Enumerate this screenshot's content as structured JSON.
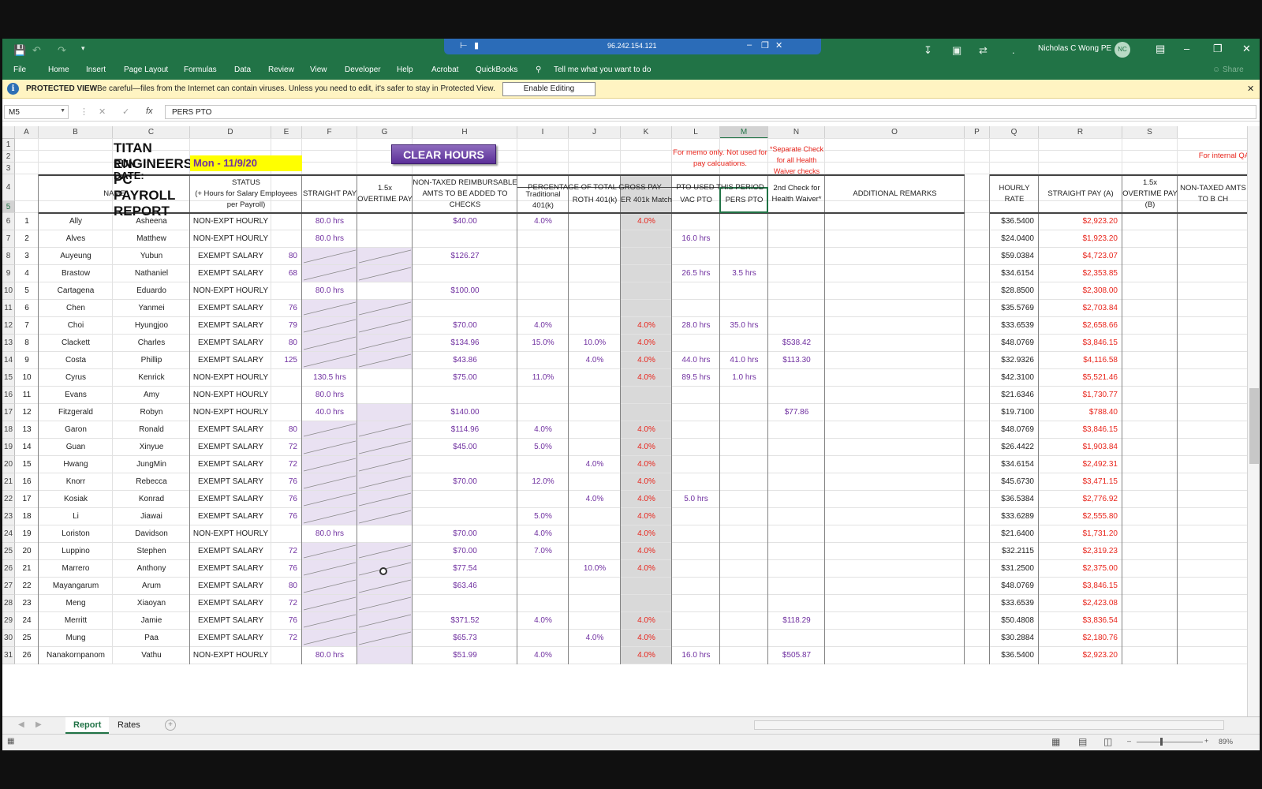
{
  "titlebar": {
    "remote_ip": "96.242.154.121",
    "user_name": "Nicholas C Wong PE",
    "user_initials": "NC"
  },
  "menu": [
    "File",
    "Home",
    "Insert",
    "Page Layout",
    "Formulas",
    "Data",
    "Review",
    "View",
    "Developer",
    "Help",
    "Acrobat",
    "QuickBooks"
  ],
  "tell_me": "Tell me what you want to do",
  "share": "Share",
  "protected_view": {
    "title": "PROTECTED VIEW",
    "message": "Be careful—files from the Internet can contain viruses. Unless you need to edit, it's safer to stay in Protected View.",
    "button": "Enable Editing"
  },
  "formula_bar": {
    "cell_ref": "M5",
    "fx": "fx",
    "content": "PERS PTO"
  },
  "columns": [
    "A",
    "B",
    "C",
    "D",
    "E",
    "F",
    "G",
    "H",
    "I",
    "J",
    "K",
    "L",
    "M",
    "N",
    "O",
    "P",
    "Q",
    "R",
    "S"
  ],
  "selected_column": "M",
  "report": {
    "title": "TITAN ENGINEERS PC PAYROLL REPORT",
    "run_date_label": "RUN DATE:",
    "run_date": "Mon - 11/9/20",
    "clear_button": "CLEAR HOURS",
    "memo_note": "For memo only. Not used for pay calcuations.",
    "separate_note": "*Separate Check for all Health Waiver checks",
    "internal_note": "For internal QA/QC"
  },
  "headers": {
    "name": "NAME",
    "status": "STATUS\n(+ Hours for Salary Employees per Payroll)",
    "straight_pay": "STRAIGHT PAY",
    "overtime": "1.5x OVERTIME PAY",
    "non_taxed": "NON-TAXED REIMBURSABLE AMTS TO BE ADDED TO CHECKS",
    "pct_group": "PERCENTAGE OF TOTAL GROSS PAY",
    "trad_401k": "Traditional 401(k)",
    "roth_401k": "ROTH 401(k)",
    "er_401k": "ER 401k Match",
    "pto_group": "PTO USED THIS PERIOD",
    "vac_pto": "VAC PTO",
    "pers_pto": "PERS PTO",
    "health_waiver": "2nd Check for Health Waiver*",
    "remarks": "ADDITIONAL REMARKS",
    "hourly_rate": "HOURLY RATE",
    "straight_pay_a": "STRAIGHT PAY (A)",
    "overtime_b": "1.5x OVERTIME PAY (B)",
    "non_taxed_trunc": "NON-TAXED AMTS TO B CH"
  },
  "employees": [
    {
      "n": "1",
      "last": "Ally",
      "first": "Asheena",
      "status": "NON-EXPT HOURLY",
      "hrs": "",
      "straight": "80.0 hrs",
      "reimb": "$40.00",
      "trad": "4.0%",
      "roth": "",
      "er": "4.0%",
      "vac": "",
      "pers": "",
      "health": "",
      "rate": "$36.5400",
      "pay": "$2,923.20"
    },
    {
      "n": "2",
      "last": "Alves",
      "first": "Matthew",
      "status": "NON-EXPT HOURLY",
      "hrs": "",
      "straight": "80.0 hrs",
      "reimb": "",
      "trad": "",
      "roth": "",
      "er": "",
      "vac": "16.0 hrs",
      "pers": "",
      "health": "",
      "rate": "$24.0400",
      "pay": "$1,923.20"
    },
    {
      "n": "3",
      "last": "Auyeung",
      "first": "Yubun",
      "status": "EXEMPT SALARY",
      "hrs": "80",
      "straight": "",
      "reimb": "$126.27",
      "trad": "",
      "roth": "",
      "er": "",
      "vac": "",
      "pers": "",
      "health": "",
      "rate": "$59.0384",
      "pay": "$4,723.07"
    },
    {
      "n": "4",
      "last": "Brastow",
      "first": "Nathaniel",
      "status": "EXEMPT SALARY",
      "hrs": "68",
      "straight": "",
      "reimb": "",
      "trad": "",
      "roth": "",
      "er": "",
      "vac": "26.5 hrs",
      "pers": "3.5 hrs",
      "health": "",
      "rate": "$34.6154",
      "pay": "$2,353.85"
    },
    {
      "n": "5",
      "last": "Cartagena",
      "first": "Eduardo",
      "status": "NON-EXPT HOURLY",
      "hrs": "",
      "straight": "80.0 hrs",
      "reimb": "$100.00",
      "trad": "",
      "roth": "",
      "er": "",
      "vac": "",
      "pers": "",
      "health": "",
      "rate": "$28.8500",
      "pay": "$2,308.00"
    },
    {
      "n": "6",
      "last": "Chen",
      "first": "Yanmei",
      "status": "EXEMPT SALARY",
      "hrs": "76",
      "straight": "",
      "reimb": "",
      "trad": "",
      "roth": "",
      "er": "",
      "vac": "",
      "pers": "",
      "health": "",
      "rate": "$35.5769",
      "pay": "$2,703.84"
    },
    {
      "n": "7",
      "last": "Choi",
      "first": "Hyungjoo",
      "status": "EXEMPT SALARY",
      "hrs": "79",
      "straight": "",
      "reimb": "$70.00",
      "trad": "4.0%",
      "roth": "",
      "er": "4.0%",
      "vac": "28.0 hrs",
      "pers": "35.0 hrs",
      "health": "",
      "rate": "$33.6539",
      "pay": "$2,658.66"
    },
    {
      "n": "8",
      "last": "Clackett",
      "first": "Charles",
      "status": "EXEMPT SALARY",
      "hrs": "80",
      "straight": "",
      "reimb": "$134.96",
      "trad": "15.0%",
      "roth": "10.0%",
      "er": "4.0%",
      "vac": "",
      "pers": "",
      "health": "$538.42",
      "rate": "$48.0769",
      "pay": "$3,846.15"
    },
    {
      "n": "9",
      "last": "Costa",
      "first": "Phillip",
      "status": "EXEMPT SALARY",
      "hrs": "125",
      "straight": "",
      "reimb": "$43.86",
      "trad": "",
      "roth": "4.0%",
      "er": "4.0%",
      "vac": "44.0 hrs",
      "pers": "41.0 hrs",
      "health": "$113.30",
      "rate": "$32.9326",
      "pay": "$4,116.58"
    },
    {
      "n": "10",
      "last": "Cyrus",
      "first": "Kenrick",
      "status": "NON-EXPT HOURLY",
      "hrs": "",
      "straight": "130.5 hrs",
      "reimb": "$75.00",
      "trad": "11.0%",
      "roth": "",
      "er": "4.0%",
      "vac": "89.5 hrs",
      "pers": "1.0 hrs",
      "health": "",
      "rate": "$42.3100",
      "pay": "$5,521.46"
    },
    {
      "n": "11",
      "last": "Evans",
      "first": "Amy",
      "status": "NON-EXPT HOURLY",
      "hrs": "",
      "straight": "80.0 hrs",
      "reimb": "",
      "trad": "",
      "roth": "",
      "er": "",
      "vac": "",
      "pers": "",
      "health": "",
      "rate": "$21.6346",
      "pay": "$1,730.77"
    },
    {
      "n": "12",
      "last": "Fitzgerald",
      "first": "Robyn",
      "status": "NON-EXPT HOURLY",
      "hrs": "",
      "straight": "40.0 hrs",
      "reimb": "$140.00",
      "trad": "",
      "roth": "",
      "er": "",
      "vac": "",
      "pers": "",
      "health": "$77.86",
      "rate": "$19.7100",
      "pay": "$788.40"
    },
    {
      "n": "13",
      "last": "Garon",
      "first": "Ronald",
      "status": "EXEMPT SALARY",
      "hrs": "80",
      "straight": "",
      "reimb": "$114.96",
      "trad": "4.0%",
      "roth": "",
      "er": "4.0%",
      "vac": "",
      "pers": "",
      "health": "",
      "rate": "$48.0769",
      "pay": "$3,846.15"
    },
    {
      "n": "14",
      "last": "Guan",
      "first": "Xinyue",
      "status": "EXEMPT SALARY",
      "hrs": "72",
      "straight": "",
      "reimb": "$45.00",
      "trad": "5.0%",
      "roth": "",
      "er": "4.0%",
      "vac": "",
      "pers": "",
      "health": "",
      "rate": "$26.4422",
      "pay": "$1,903.84"
    },
    {
      "n": "15",
      "last": "Hwang",
      "first": "JungMin",
      "status": "EXEMPT SALARY",
      "hrs": "72",
      "straight": "",
      "reimb": "",
      "trad": "",
      "roth": "4.0%",
      "er": "4.0%",
      "vac": "",
      "pers": "",
      "health": "",
      "rate": "$34.6154",
      "pay": "$2,492.31"
    },
    {
      "n": "16",
      "last": "Knorr",
      "first": "Rebecca",
      "status": "EXEMPT SALARY",
      "hrs": "76",
      "straight": "",
      "reimb": "$70.00",
      "trad": "12.0%",
      "roth": "",
      "er": "4.0%",
      "vac": "",
      "pers": "",
      "health": "",
      "rate": "$45.6730",
      "pay": "$3,471.15"
    },
    {
      "n": "17",
      "last": "Kosiak",
      "first": "Konrad",
      "status": "EXEMPT SALARY",
      "hrs": "76",
      "straight": "",
      "reimb": "",
      "trad": "",
      "roth": "4.0%",
      "er": "4.0%",
      "vac": "5.0 hrs",
      "pers": "",
      "health": "",
      "rate": "$36.5384",
      "pay": "$2,776.92"
    },
    {
      "n": "18",
      "last": "Li",
      "first": "Jiawai",
      "status": "EXEMPT SALARY",
      "hrs": "76",
      "straight": "",
      "reimb": "",
      "trad": "5.0%",
      "roth": "",
      "er": "4.0%",
      "vac": "",
      "pers": "",
      "health": "",
      "rate": "$33.6289",
      "pay": "$2,555.80"
    },
    {
      "n": "19",
      "last": "Loriston",
      "first": "Davidson",
      "status": "NON-EXPT HOURLY",
      "hrs": "",
      "straight": "80.0 hrs",
      "reimb": "$70.00",
      "trad": "4.0%",
      "roth": "",
      "er": "4.0%",
      "vac": "",
      "pers": "",
      "health": "",
      "rate": "$21.6400",
      "pay": "$1,731.20"
    },
    {
      "n": "20",
      "last": "Luppino",
      "first": "Stephen",
      "status": "EXEMPT SALARY",
      "hrs": "72",
      "straight": "",
      "reimb": "$70.00",
      "trad": "7.0%",
      "roth": "",
      "er": "4.0%",
      "vac": "",
      "pers": "",
      "health": "",
      "rate": "$32.2115",
      "pay": "$2,319.23"
    },
    {
      "n": "21",
      "last": "Marrero",
      "first": "Anthony",
      "status": "EXEMPT SALARY",
      "hrs": "76",
      "straight": "",
      "reimb": "$77.54",
      "trad": "",
      "roth": "10.0%",
      "er": "4.0%",
      "vac": "",
      "pers": "",
      "health": "",
      "rate": "$31.2500",
      "pay": "$2,375.00"
    },
    {
      "n": "22",
      "last": "Mayangarum",
      "first": "Arum",
      "status": "EXEMPT SALARY",
      "hrs": "80",
      "straight": "",
      "reimb": "$63.46",
      "trad": "",
      "roth": "",
      "er": "",
      "vac": "",
      "pers": "",
      "health": "",
      "rate": "$48.0769",
      "pay": "$3,846.15"
    },
    {
      "n": "23",
      "last": "Meng",
      "first": "Xiaoyan",
      "status": "EXEMPT SALARY",
      "hrs": "72",
      "straight": "",
      "reimb": "",
      "trad": "",
      "roth": "",
      "er": "",
      "vac": "",
      "pers": "",
      "health": "",
      "rate": "$33.6539",
      "pay": "$2,423.08"
    },
    {
      "n": "24",
      "last": "Merritt",
      "first": "Jamie",
      "status": "EXEMPT SALARY",
      "hrs": "76",
      "straight": "",
      "reimb": "$371.52",
      "trad": "4.0%",
      "roth": "",
      "er": "4.0%",
      "vac": "",
      "pers": "",
      "health": "$118.29",
      "rate": "$50.4808",
      "pay": "$3,836.54"
    },
    {
      "n": "25",
      "last": "Mung",
      "first": "Paa",
      "status": "EXEMPT SALARY",
      "hrs": "72",
      "straight": "",
      "reimb": "$65.73",
      "trad": "",
      "roth": "4.0%",
      "er": "4.0%",
      "vac": "",
      "pers": "",
      "health": "",
      "rate": "$30.2884",
      "pay": "$2,180.76"
    },
    {
      "n": "26",
      "last": "Nanakornpanom",
      "first": "Vathu",
      "status": "NON-EXPT HOURLY",
      "hrs": "",
      "straight": "80.0 hrs",
      "reimb": "$51.99",
      "trad": "4.0%",
      "roth": "",
      "er": "4.0%",
      "vac": "16.0 hrs",
      "pers": "",
      "health": "$505.87",
      "rate": "$36.5400",
      "pay": "$2,923.20"
    }
  ],
  "sheets": [
    "Report",
    "Rates"
  ],
  "active_sheet": "Report",
  "zoom": "89%"
}
